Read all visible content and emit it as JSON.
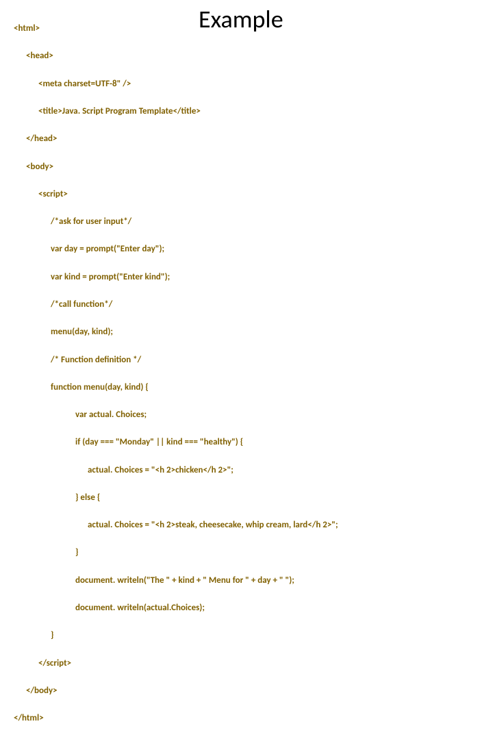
{
  "title": "Example",
  "code": {
    "l0": "<html>",
    "l1": "<head>",
    "l2": "<meta charset=UTF-8\" />",
    "l3": "<title>Java. Script Program Template</title>",
    "l4": "</head>",
    "l5": "<body>",
    "l6": "<script>",
    "l7": "/*ask for user input*/",
    "l8": "var day = prompt(\"Enter day\");",
    "l9": "var kind = prompt(\"Enter kind\");",
    "l10": "/*call function*/",
    "l11": "menu(day, kind);",
    "l12": "/* Function definition */",
    "l13": "function menu(day, kind) {",
    "l14": "var actual. Choices;",
    "l15": "if (day === \"Monday\" || kind === \"healthy\") {",
    "l16": "actual. Choices = \"<h 2>chicken</h 2>\";",
    "l17": "} else {",
    "l18": "actual. Choices = \"<h 2>steak, cheesecake, whip cream, lard</h 2>\";",
    "l19": "}",
    "l20": "document. writeln(\"The \" + kind + \" Menu for \" + day + \" \");",
    "l21": "document. writeln(actual.Choices);",
    "l22": "}",
    "l23": "</script>",
    "l24": "</body>",
    "l25": "</html>"
  }
}
